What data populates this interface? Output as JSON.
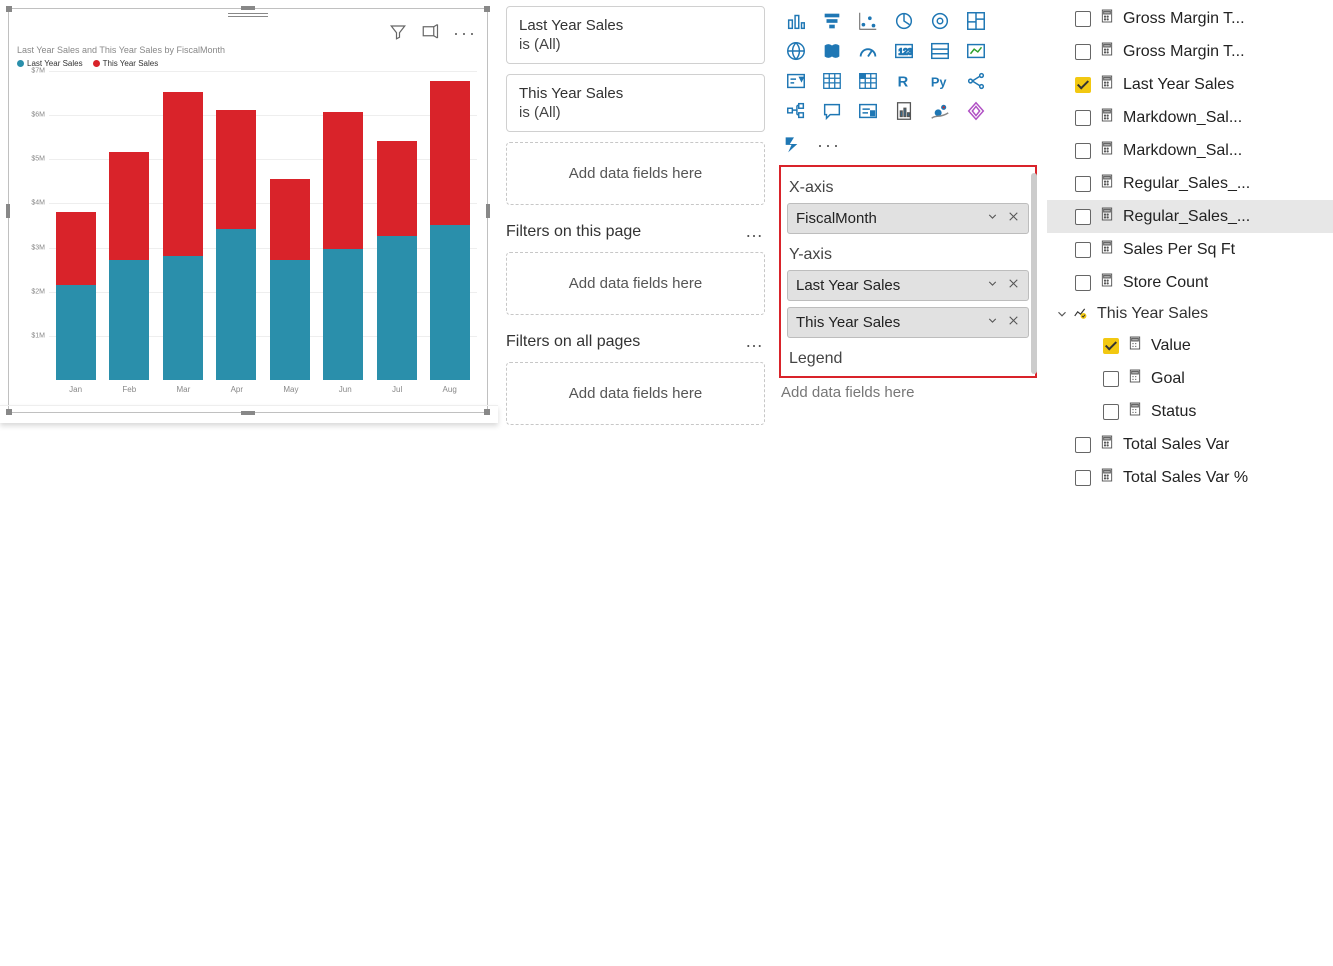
{
  "colors": {
    "lastYear": "#2a8fab",
    "thisYear": "#d9232a",
    "accentYellow": "#f2c811",
    "iconBlue": "#1f77b4"
  },
  "chart": {
    "title": "Last Year Sales and This Year Sales by FiscalMonth",
    "legend": {
      "series1": "Last Year Sales",
      "series2": "This Year Sales"
    }
  },
  "chart_data": {
    "type": "bar",
    "stacked": true,
    "title": "Last Year Sales and This Year Sales by FiscalMonth",
    "xlabel": "FiscalMonth",
    "ylabel": "",
    "ylim": [
      0,
      7000000
    ],
    "yticks": [
      "$1M",
      "$2M",
      "$3M",
      "$4M",
      "$5M",
      "$6M",
      "$7M"
    ],
    "categories": [
      "Jan",
      "Feb",
      "Mar",
      "Apr",
      "May",
      "Jun",
      "Jul",
      "Aug"
    ],
    "series": [
      {
        "name": "Last Year Sales",
        "color": "#2a8fab",
        "values": [
          2150000,
          2700000,
          2800000,
          3400000,
          2700000,
          2950000,
          3250000,
          3500000
        ]
      },
      {
        "name": "This Year Sales",
        "color": "#d9232a",
        "values": [
          1650000,
          2450000,
          3700000,
          2700000,
          1850000,
          3100000,
          2150000,
          3250000
        ]
      }
    ]
  },
  "filters": {
    "visual": [
      {
        "name": "Last Year Sales",
        "sub": "is (All)"
      },
      {
        "name": "This Year Sales",
        "sub": "is (All)"
      }
    ],
    "visual_drop": "Add data fields here",
    "page_label": "Filters on this page",
    "page_drop": "Add data fields here",
    "all_label": "Filters on all pages",
    "all_drop": "Add data fields here"
  },
  "wells": {
    "xaxis_label": "X-axis",
    "xaxis_pill": "FiscalMonth",
    "yaxis_label": "Y-axis",
    "yaxis_pill1": "Last Year Sales",
    "yaxis_pill2": "This Year Sales",
    "legend_label": "Legend",
    "legend_drop": "Add data fields here"
  },
  "fields": {
    "items": [
      {
        "label": "Gross Margin T...",
        "checked": false,
        "icon": "calc"
      },
      {
        "label": "Gross Margin T...",
        "checked": false,
        "icon": "calc"
      },
      {
        "label": "Last Year Sales",
        "checked": true,
        "icon": "calc"
      },
      {
        "label": "Markdown_Sal...",
        "checked": false,
        "icon": "calc"
      },
      {
        "label": "Markdown_Sal...",
        "checked": false,
        "icon": "calc"
      },
      {
        "label": "Regular_Sales_...",
        "checked": false,
        "icon": "calc"
      },
      {
        "label": "Regular_Sales_...",
        "checked": false,
        "icon": "calc",
        "selected": true
      },
      {
        "label": "Sales Per Sq Ft",
        "checked": false,
        "icon": "calc"
      },
      {
        "label": "Store Count",
        "checked": false,
        "icon": "calc"
      }
    ],
    "kpi_group": "This Year Sales",
    "kpi_children": [
      {
        "label": "Value",
        "checked": true
      },
      {
        "label": "Goal",
        "checked": false
      },
      {
        "label": "Status",
        "checked": false
      }
    ],
    "tail": [
      {
        "label": "Total Sales Var",
        "checked": false
      },
      {
        "label": "Total Sales Var %",
        "checked": false
      }
    ]
  }
}
